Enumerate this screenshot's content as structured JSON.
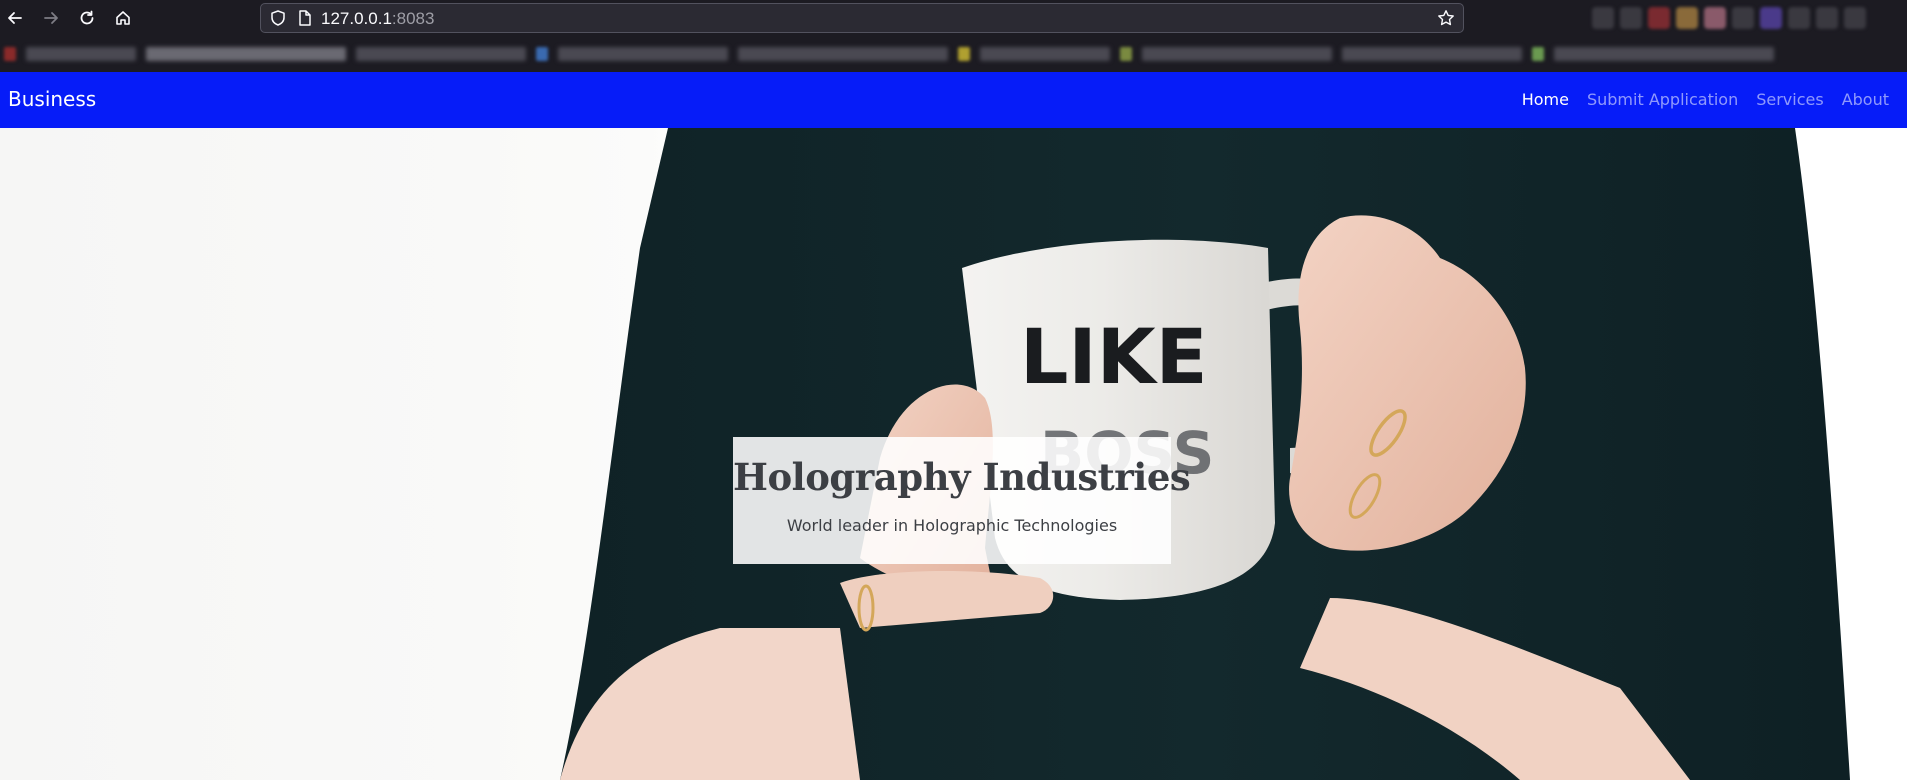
{
  "browser": {
    "url_host": "127.0.0.1",
    "url_port": ":8083",
    "icons": [
      "back-icon",
      "forward-icon",
      "reload-icon",
      "home-icon",
      "shield-icon",
      "page-icon",
      "bookmark-star-icon"
    ]
  },
  "navbar": {
    "brand": "Business",
    "links": [
      {
        "label": "Home",
        "active": true
      },
      {
        "label": "Submit Application",
        "active": false
      },
      {
        "label": "Services",
        "active": false
      },
      {
        "label": "About",
        "active": false
      }
    ],
    "color": "#061cf8"
  },
  "hero": {
    "title": "Holography Industries",
    "subtitle": "World leader in Holographic Technologies",
    "mug_text_line1": "LIKE",
    "mug_text_line2": "BOSS"
  }
}
